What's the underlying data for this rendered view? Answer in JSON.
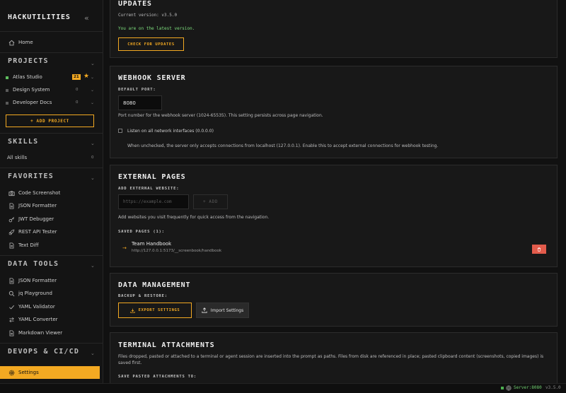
{
  "app": {
    "title": "HACKUTILITIES",
    "collapse_icon": "double-chevron-left-icon"
  },
  "sidebar": {
    "home": "Home",
    "projects": {
      "title": "PROJECTS",
      "items": [
        {
          "name": "Atlas Studio",
          "badge": "21",
          "starred": true,
          "status_color": "#5fbf5f"
        },
        {
          "name": "Design System",
          "count": "0"
        },
        {
          "name": "Developer Docs",
          "count": "0"
        }
      ],
      "add_label": "+ ADD PROJECT"
    },
    "skills": {
      "title": "SKILLS",
      "items": [
        {
          "name": "All skills",
          "count": "0"
        }
      ]
    },
    "favorites": {
      "title": "FAVORITES",
      "items": [
        {
          "name": "Code Screenshot",
          "icon": "camera-icon"
        },
        {
          "name": "JSON Formatter",
          "icon": "document-icon"
        },
        {
          "name": "JWT Debugger",
          "icon": "key-icon"
        },
        {
          "name": "REST API Tester",
          "icon": "rocket-icon"
        },
        {
          "name": "Text Diff",
          "icon": "document-icon"
        }
      ]
    },
    "data_tools": {
      "title": "DATA TOOLS",
      "items": [
        {
          "name": "JSON Formatter",
          "icon": "document-icon"
        },
        {
          "name": "jq Playground",
          "icon": "search-icon"
        },
        {
          "name": "YAML Validator",
          "icon": "check-icon"
        },
        {
          "name": "YAML Converter",
          "icon": "swap-icon"
        },
        {
          "name": "Markdown Viewer",
          "icon": "document-icon"
        }
      ]
    },
    "devops": {
      "title": "DEVOPS & CI/CD"
    },
    "settings": "Settings"
  },
  "updates": {
    "title": "UPDATES",
    "current_version": "Current version: v3.5.0",
    "status": "You are on the latest version.",
    "check_button": "CHECK FOR UPDATES"
  },
  "webhook": {
    "title": "WEBHOOK SERVER",
    "port_label": "DEFAULT PORT:",
    "port_value": "8080",
    "port_help": "Port number for the webhook server (1024-65535). This setting persists across page navigation.",
    "listen_label": "Listen on all network interfaces (0.0.0.0)",
    "listen_checked": false,
    "listen_help": "When unchecked, the server only accepts connections from localhost (127.0.0.1). Enable this to accept external connections for webhook testing."
  },
  "external_pages": {
    "title": "EXTERNAL PAGES",
    "add_label": "ADD EXTERNAL WEBSITE:",
    "url_placeholder": "https://example.com",
    "add_button": "+ ADD",
    "help": "Add websites you visit frequently for quick access from the navigation.",
    "saved_label": "SAVED PAGES (1):",
    "pages": [
      {
        "name": "Team Handbook",
        "url": "http://127.0.0.1:5173/__screenbook/handbook"
      }
    ]
  },
  "data_management": {
    "title": "DATA MANAGEMENT",
    "backup_label": "BACKUP & RESTORE:",
    "export_button": "EXPORT SETTINGS",
    "import_button": "Import Settings"
  },
  "terminal": {
    "title": "TERMINAL ATTACHMENTS",
    "description": "Files dropped, pasted or attached to a terminal or agent session are inserted into the prompt as paths. Files from disk are referenced in place; pasted clipboard content (screenshots, copied images) is saved first.",
    "save_label": "SAVE PASTED ATTACHMENTS TO:"
  },
  "status_bar": {
    "server": "Server:8080",
    "version": "v3.5.0",
    "server_color": "#4caf50"
  },
  "colors": {
    "accent": "#f3a922",
    "danger": "#e25b4b",
    "success": "#7ee07e"
  }
}
